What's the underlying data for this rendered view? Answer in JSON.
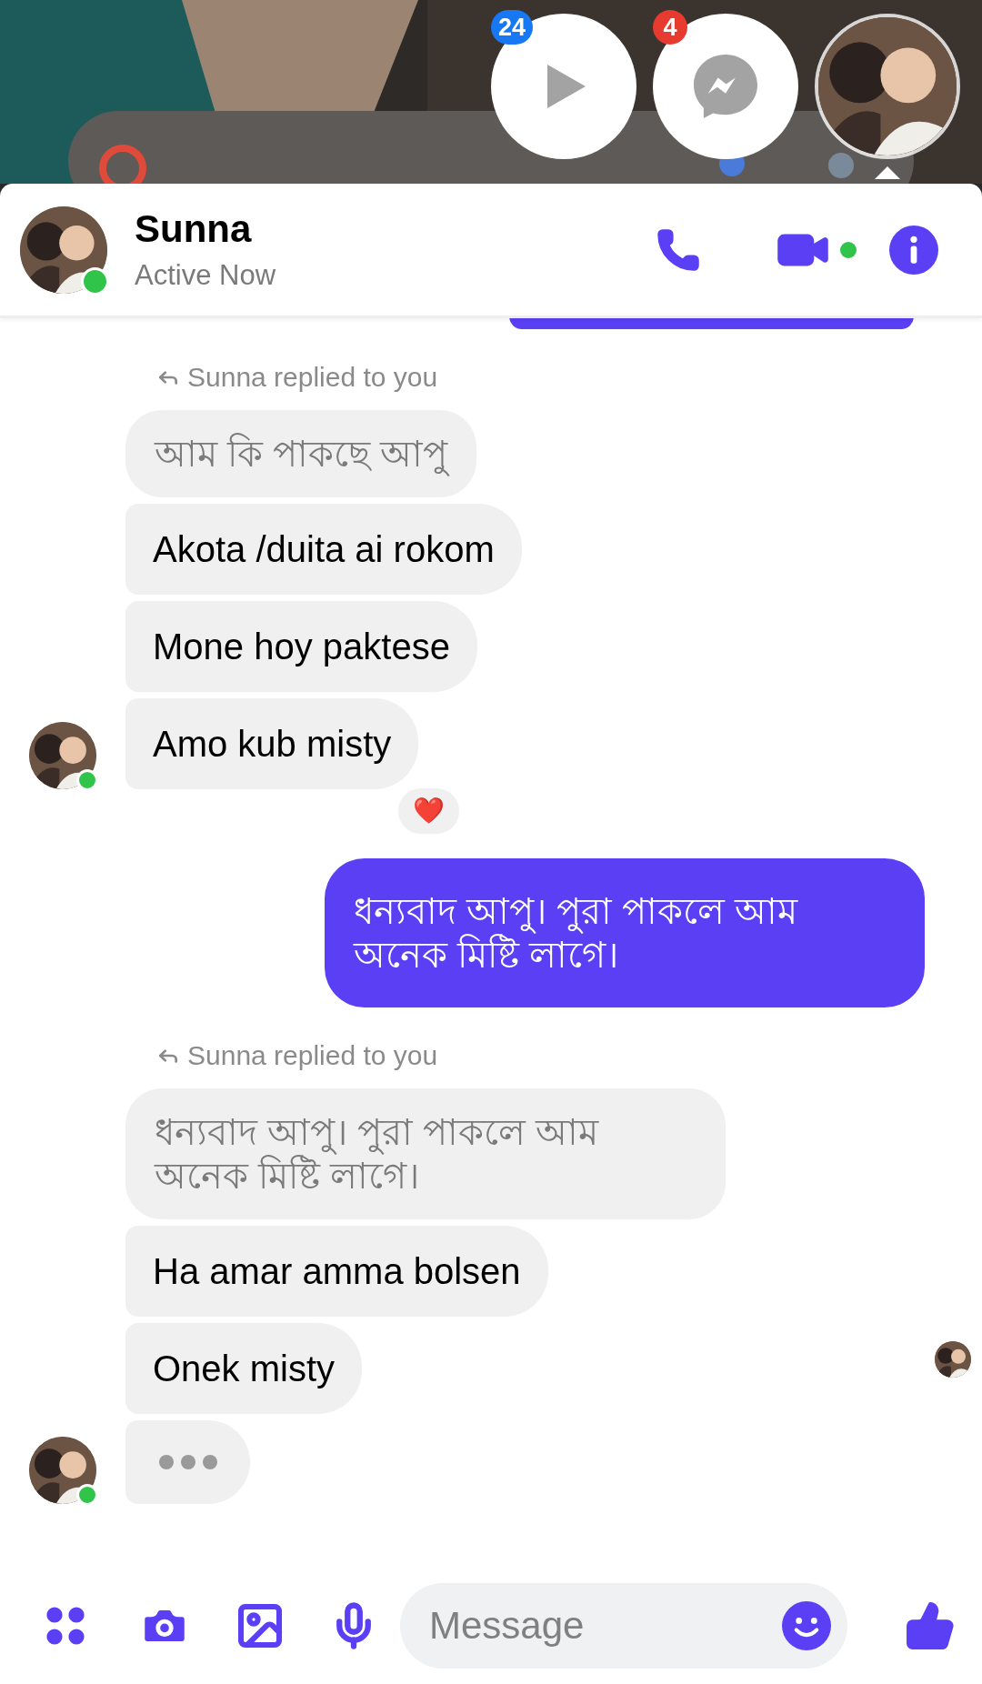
{
  "home_screen": {
    "bubbles": [
      {
        "kind": "video",
        "badge": "24"
      },
      {
        "kind": "messenger",
        "badge": "4"
      },
      {
        "kind": "avatar"
      }
    ]
  },
  "chat_header": {
    "name": "Sunna",
    "status": "Active Now",
    "online": true
  },
  "messages": [
    {
      "kind": "partial_sent"
    },
    {
      "kind": "reply_note",
      "text": "Sunna replied to you"
    },
    {
      "kind": "quoted",
      "text": "আম কি পাকছে আপু"
    },
    {
      "kind": "received",
      "text": "Akota /duita ai rokom"
    },
    {
      "kind": "received",
      "text": "Mone hoy paktese"
    },
    {
      "kind": "received",
      "text": "Amo kub misty",
      "avatar": true,
      "online": true,
      "reaction": "❤️"
    },
    {
      "kind": "sent",
      "text": "ধন্যবাদ আপু। পুরা পাকলে আম অনেক মিষ্টি লাগে।"
    },
    {
      "kind": "reply_note",
      "text": "Sunna replied to you"
    },
    {
      "kind": "quoted",
      "text": "ধন্যবাদ আপু। পুরা পাকলে আম অনেক মিষ্টি লাগে।"
    },
    {
      "kind": "received",
      "text": "Ha amar amma bolsen"
    },
    {
      "kind": "received",
      "text": "Onek misty",
      "seen": true
    },
    {
      "kind": "typing",
      "avatar": true,
      "online": true
    }
  ],
  "composer": {
    "placeholder": "Message"
  }
}
